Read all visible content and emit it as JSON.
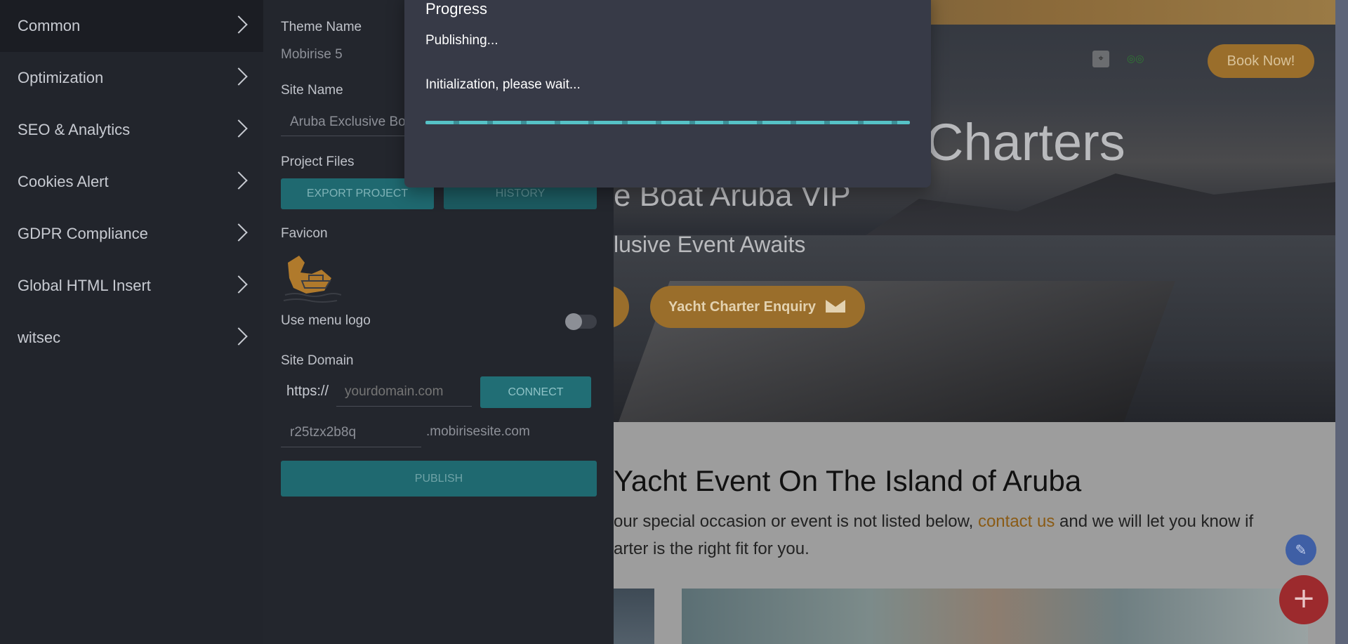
{
  "side_nav": {
    "items": [
      {
        "label": "Common"
      },
      {
        "label": "Optimization"
      },
      {
        "label": "SEO & Analytics"
      },
      {
        "label": "Cookies Alert"
      },
      {
        "label": "GDPR Compliance"
      },
      {
        "label": "Global HTML Insert"
      },
      {
        "label": "witsec"
      }
    ]
  },
  "settings": {
    "theme_name_label": "Theme Name",
    "theme_name_value": "Mobirise 5",
    "site_name_label": "Site Name",
    "site_name_value": "Aruba Exclusive Bo",
    "project_files_label": "Project Files",
    "export_label": "EXPORT PROJECT",
    "history_label": "HISTORY",
    "favicon_label": "Favicon",
    "use_menu_logo_label": "Use menu logo",
    "use_menu_logo_on": false,
    "site_domain_label": "Site Domain",
    "https_prefix": "https://",
    "domain_placeholder": "yourdomain.com",
    "connect_label": "CONNECT",
    "subdomain_value": "r25tzx2b8q",
    "subdomain_suffix": ".mobirisesite.com",
    "publish_label": "PUBLISH"
  },
  "progress": {
    "title": "Progress",
    "status": "Publishing...",
    "message": "Initialization, please wait...",
    "fraction": 1.0
  },
  "preview": {
    "book_now": "Book Now!",
    "hero_title": "Charters",
    "hero_sub": "e Boat Aruba VIP",
    "hero_sub2": "lusive Event Awaits",
    "enquiry_label": "Yacht Charter Enquiry",
    "section_title": "Yacht Event On The Island of Aruba",
    "section_text_before": "our special occasion or event is not listed below, ",
    "contact_link": "contact us",
    "section_text_after": " and we will let you know if",
    "section_text_line2": "arter is the right fit for you.",
    "fab_add": "+",
    "fab_edit": "✎"
  },
  "colors": {
    "accent_teal": "#1f6970",
    "book_gold": "#9a6e2b",
    "fab_red": "#9c2a2d",
    "fab_blue": "#3f5fa5"
  }
}
